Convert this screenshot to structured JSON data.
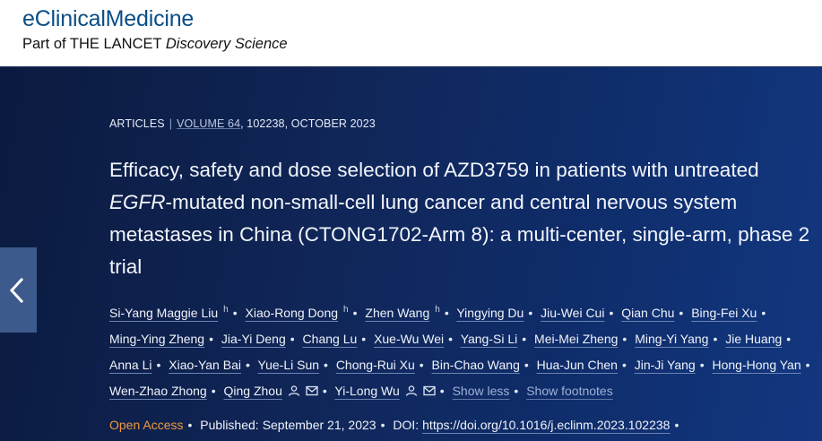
{
  "header": {
    "brand": "eClinicalMedicine",
    "sub_prefix": "Part of THE LANCET",
    "sub_italic": "Discovery Science"
  },
  "meta": {
    "section": "ARTICLES",
    "volume": "VOLUME 64",
    "rest": ", 102238, OCTOBER 2023"
  },
  "title": {
    "part1": "Efficacy, safety and dose selection of AZD3759 in patients with untreated",
    "italic": "EGFR",
    "part2": "-mutated non-small-cell lung cancer and central nervous system metastases in China (CTONG1702-Arm 8): a multi-center, single-arm, phase 2 trial"
  },
  "authors": [
    "Si-Yang Maggie Liu",
    "Xiao-Rong Dong",
    "Zhen Wang",
    "Yingying Du",
    "Jiu-Wei Cui",
    "Qian Chu",
    "Bing-Fei Xu",
    "Ming-Ying Zheng",
    "Jia-Yi Deng",
    "Chang Lu",
    "Xue-Wu Wei",
    "Yang-Si Li",
    "Mei-Mei Zheng",
    "Ming-Yi Yang",
    "Jie Huang",
    "Anna Li",
    "Xiao-Yan Bai",
    "Yue-Li Sun",
    "Chong-Rui Xu",
    "Bin-Chao Wang",
    "Hua-Jun Chen",
    "Jin-Ji Yang",
    "Hong-Hong Yan",
    "Wen-Zhao Zhong",
    "Qing Zhou",
    "Yi-Long Wu"
  ],
  "author_sup": "h",
  "actions": {
    "show_less": "Show less",
    "show_footnotes": "Show footnotes"
  },
  "publication": {
    "open_access": "Open Access",
    "published_label": "Published:",
    "published_date": "September 21, 2023",
    "doi_label": "DOI:",
    "doi": "https://doi.org/10.1016/j.eclinm.2023.102238"
  },
  "icons": {
    "prev": "chevron-left-icon",
    "person": "person-icon",
    "mail": "mail-icon"
  },
  "colors": {
    "hero": "#102658",
    "brand": "#0a4d86",
    "open_access": "#f09a3e"
  }
}
